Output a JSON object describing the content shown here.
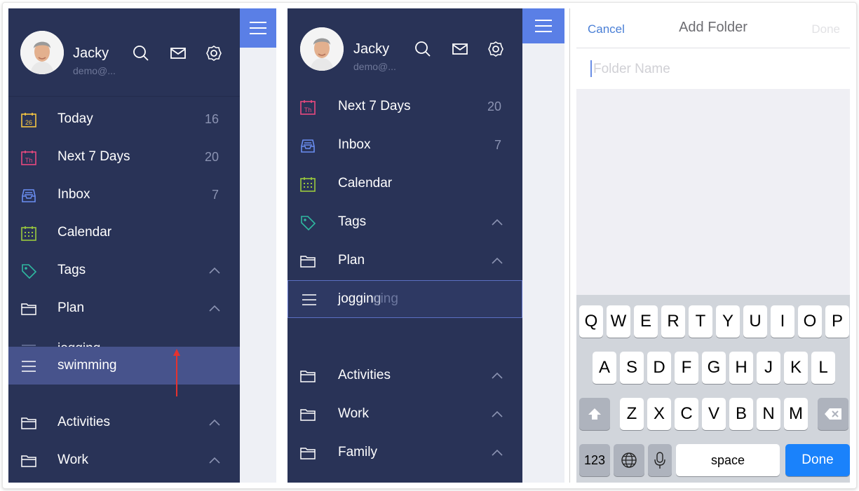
{
  "screen1": {
    "user": {
      "name": "Jacky",
      "email": "demo@..."
    },
    "items": [
      {
        "label": "Today",
        "count": "16",
        "icon": "calendar-day-icon",
        "icon_text": "26",
        "color": "#f5c542"
      },
      {
        "label": "Next 7 Days",
        "count": "20",
        "icon": "calendar-week-icon",
        "icon_text": "Th",
        "color": "#e8497f"
      },
      {
        "label": "Inbox",
        "count": "7",
        "icon": "inbox-icon",
        "color": "#6a8ef2"
      },
      {
        "label": "Calendar",
        "count": "",
        "icon": "calendar-grid-icon",
        "color": "#9bcb3c"
      },
      {
        "label": "Tags",
        "count": "",
        "icon": "tag-icon",
        "color": "#2fb8a0"
      },
      {
        "label": "Plan",
        "count": "",
        "icon": "folder-icon",
        "color": "#ffffff"
      }
    ],
    "ghost_label": "jogging",
    "drag_label": "swimming",
    "folders": [
      {
        "label": "Activities",
        "icon": "folder-icon"
      },
      {
        "label": "Work",
        "icon": "folder-icon"
      }
    ]
  },
  "screen2": {
    "user": {
      "name": "Jacky",
      "email": "demo@..."
    },
    "items": [
      {
        "label": "Next 7 Days",
        "count": "20",
        "icon": "calendar-week-icon",
        "icon_text": "Th",
        "color": "#e8497f"
      },
      {
        "label": "Inbox",
        "count": "7",
        "icon": "inbox-icon",
        "color": "#6a8ef2"
      },
      {
        "label": "Calendar",
        "count": "",
        "icon": "calendar-grid-icon",
        "color": "#9bcb3c"
      },
      {
        "label": "Tags",
        "count": "",
        "icon": "tag-icon",
        "color": "#2fb8a0"
      },
      {
        "label": "Plan",
        "count": "",
        "icon": "folder-icon",
        "color": "#ffffff"
      }
    ],
    "drag_label": "jogging",
    "ghost_tail": "ging",
    "folders": [
      {
        "label": "Activities",
        "icon": "folder-icon"
      },
      {
        "label": "Work",
        "icon": "folder-icon"
      },
      {
        "label": "Family",
        "icon": "folder-icon"
      }
    ]
  },
  "screen3": {
    "nav": {
      "cancel": "Cancel",
      "title": "Add Folder",
      "done": "Done"
    },
    "field": {
      "placeholder": "Folder Name"
    },
    "keyboard": {
      "row1": [
        "Q",
        "W",
        "E",
        "R",
        "T",
        "Y",
        "U",
        "I",
        "O",
        "P"
      ],
      "row2": [
        "A",
        "S",
        "D",
        "F",
        "G",
        "H",
        "J",
        "K",
        "L"
      ],
      "row3": [
        "Z",
        "X",
        "C",
        "V",
        "B",
        "N",
        "M"
      ],
      "numbers": "123",
      "space": "space",
      "done": "Done"
    }
  },
  "colors": {
    "sidebar": "#293357",
    "accent": "#5a7fe6",
    "drag_highlight": "#47538c",
    "ios_blue": "#1a82fb"
  }
}
